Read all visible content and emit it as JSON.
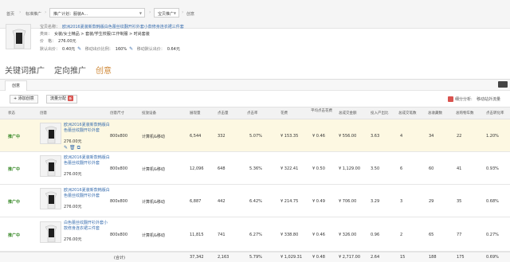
{
  "breadcrumb": {
    "home": "首页",
    "standard": "标准推广",
    "plan_prefix": "推广计划：",
    "plan_value": "服装A...",
    "unit": "宝贝推广",
    "creative": "创意"
  },
  "product": {
    "title_label": "宝贝名称：",
    "title": "欧洲2016夏装新款韩版白色蕾丝纹翻开衫外套",
    "title_tail": "小款修身连衣裙三件套",
    "category_label": "类目：",
    "category": "女装/女士精品 > 套装/学生校服/工作制服 > 时尚套装",
    "price_label": "价　格：",
    "price": "276.00元",
    "default_bid_label": "默认出价：",
    "default_bid": "0.40元",
    "mobile_ratio_label": "移动出价比例：",
    "mobile_ratio": "160%",
    "mobile_bid_label": "移动默认出价：",
    "mobile_bid": "0.64元"
  },
  "tabs": [
    {
      "label": "关键词推广"
    },
    {
      "label": "定向推广"
    },
    {
      "label": "创意"
    }
  ],
  "subtab": "创意",
  "toolbar": {
    "add_creative": "+ 添加创意",
    "traffic_split": "流量分配",
    "split_badge": "新",
    "segment": "细分分析:",
    "mobile_traffic": "移动站外流量"
  },
  "columns": [
    "状态",
    "创意",
    "创意尺寸",
    "投放设备",
    "展现量",
    "点击量",
    "点击率",
    "花费",
    "平均点击花费",
    "总成交金额",
    "投入产出比",
    "总成交笔数",
    "总收藏数",
    "总购物车数",
    "点击转化率"
  ],
  "rows": [
    {
      "status": "推广中",
      "title": "欧洲2016夏装新款韩版白色蕾丝纹翻开衫外套",
      "price": "276.00元",
      "size": "800x800",
      "device": "计算机&移动",
      "impressions": "6,544",
      "clicks": "332",
      "ctr": "5.07%",
      "cost": "¥ 153.35",
      "cpc": "¥ 0.46",
      "gmv": "¥ 556.00",
      "roi": "3.63",
      "orders": "4",
      "favs": "34",
      "carts": "22",
      "cvr": "1.20%"
    },
    {
      "status": "推广中",
      "title": "欧洲2016夏装新款韩版白色蕾丝纹翻开衫外套",
      "price": "276.00元",
      "size": "800x800",
      "device": "计算机&移动",
      "impressions": "12,096",
      "clicks": "648",
      "ctr": "5.36%",
      "cost": "¥ 322.41",
      "cpc": "¥ 0.50",
      "gmv": "¥ 1,129.00",
      "roi": "3.50",
      "orders": "6",
      "favs": "60",
      "carts": "41",
      "cvr": "0.93%"
    },
    {
      "status": "推广中",
      "title": "欧洲2016夏装新款韩版白色蕾丝纹翻开衫外套",
      "price": "276.00元",
      "size": "800x800",
      "device": "计算机&移动",
      "impressions": "6,887",
      "clicks": "442",
      "ctr": "6.42%",
      "cost": "¥ 214.75",
      "cpc": "¥ 0.49",
      "gmv": "¥ 706.00",
      "roi": "3.29",
      "orders": "3",
      "favs": "29",
      "carts": "35",
      "cvr": "0.68%"
    },
    {
      "status": "推广中",
      "title": "白色蕾丝纹翻开衫外套小款修身连衣裙三件套",
      "price": "276.00元",
      "size": "800x800",
      "device": "计算机&移动",
      "impressions": "11,815",
      "clicks": "741",
      "ctr": "6.27%",
      "cost": "¥ 338.80",
      "cpc": "¥ 0.46",
      "gmv": "¥ 326.00",
      "roi": "0.96",
      "orders": "2",
      "favs": "65",
      "carts": "77",
      "cvr": "0.27%"
    }
  ],
  "totals": {
    "label": "(合计)",
    "impressions": "37,342",
    "clicks": "2,163",
    "ctr": "5.79%",
    "cost": "¥ 1,029.31",
    "cpc": "¥ 0.48",
    "gmv": "¥ 2,717.00",
    "roi": "2.64",
    "orders": "15",
    "favs": "188",
    "carts": "175",
    "cvr": "0.69%"
  },
  "colors": {
    "accent": "#e08a2c",
    "link": "#3a6fb0",
    "status": "#3a8a2a",
    "highlight": "#fdf8e2"
  }
}
